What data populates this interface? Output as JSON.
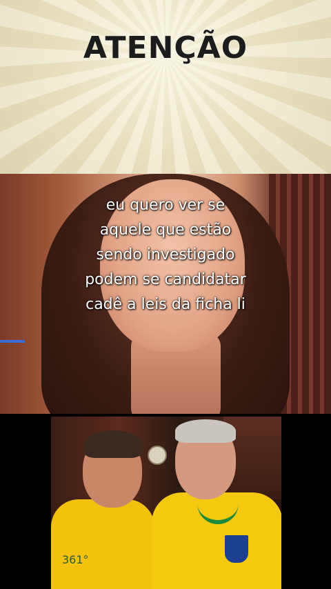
{
  "banner": {
    "title": "ATENÇÃO"
  },
  "caption": {
    "lines": [
      "eu  quero ver se",
      "aquele que  estão",
      "sendo investigado",
      "podem se candidatar",
      "cadê a leis da ficha li"
    ]
  },
  "photo": {
    "shirt_text": "361°"
  }
}
